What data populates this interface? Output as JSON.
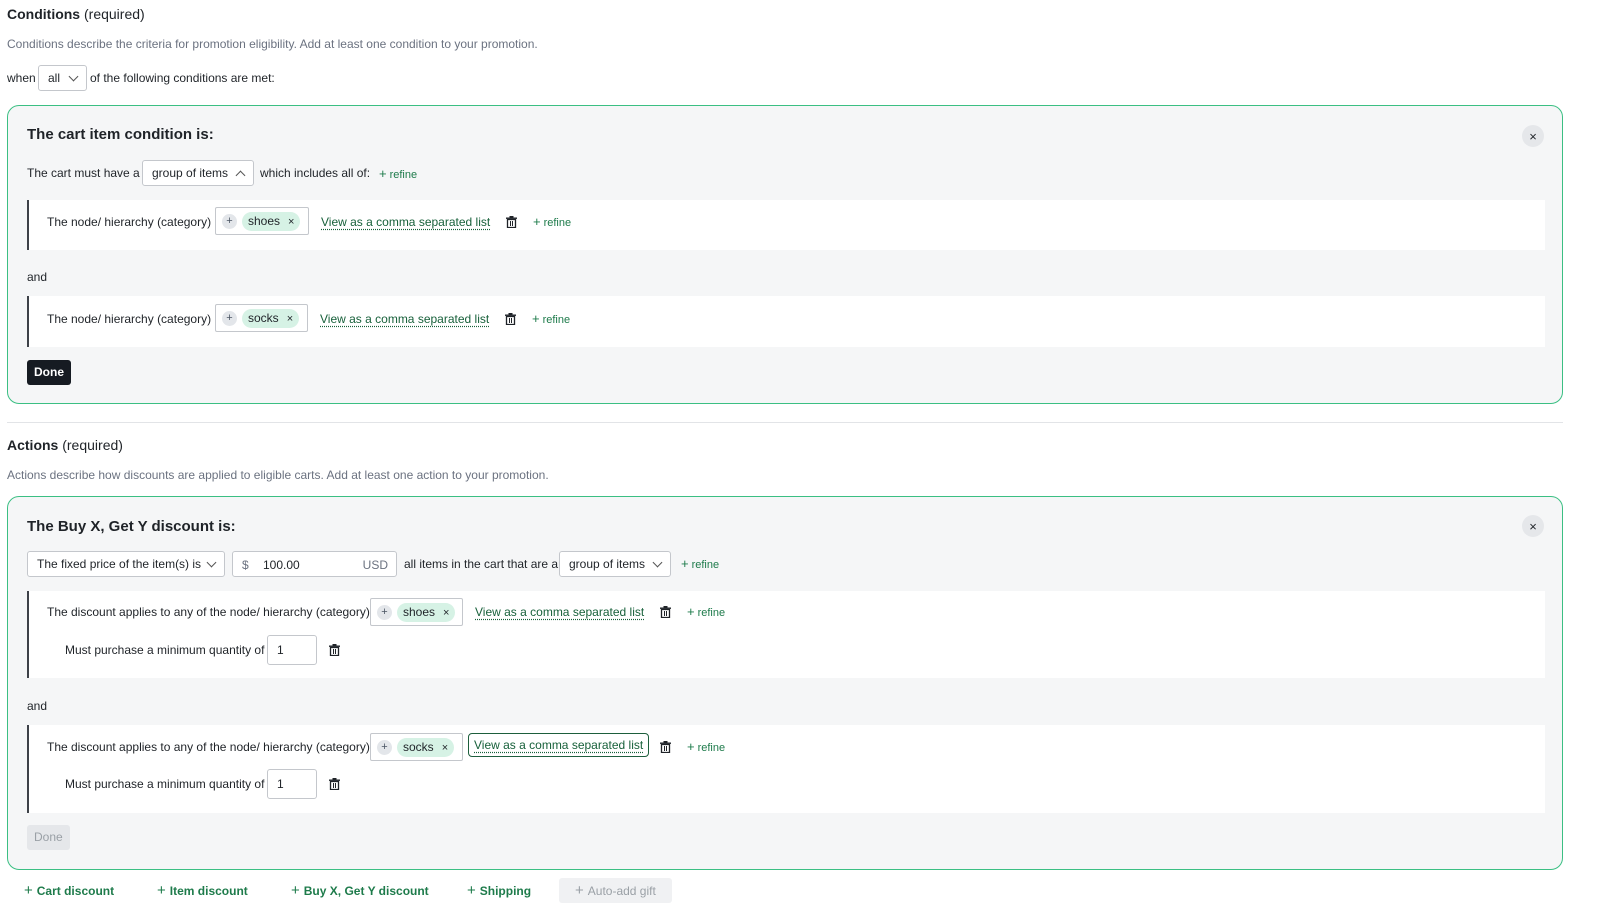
{
  "conditions": {
    "title": "Conditions",
    "required": "(required)",
    "description": "Conditions describe the criteria for promotion eligibility. Add at least one condition to your promotion.",
    "when_label": "when",
    "when_value": "all",
    "when_suffix": "of the following conditions are met:",
    "card": {
      "title": "The cart item condition is:",
      "close": "×",
      "must_have": "The cart must have a",
      "group_select": "group of items",
      "includes": "which includes all of:",
      "refine": "refine",
      "and": "and",
      "rows": [
        {
          "label": "The node/ hierarchy (category)",
          "plus": "+",
          "chip": "shoes",
          "chip_x": "×",
          "link": "View as a comma separated list",
          "refine": "refine"
        },
        {
          "label": "The node/ hierarchy (category)",
          "plus": "+",
          "chip": "socks",
          "chip_x": "×",
          "link": "View as a comma separated list",
          "refine": "refine"
        }
      ],
      "done": "Done"
    }
  },
  "actions": {
    "title": "Actions",
    "required": "(required)",
    "description": "Actions describe how discounts are applied to eligible carts. Add at least one action to your promotion.",
    "card": {
      "title": "The Buy X, Get Y discount is:",
      "close": "×",
      "price_type": "The fixed price of the item(s) is",
      "currency_symbol": "$",
      "price_value": "100.00",
      "currency": "USD",
      "applies_text": "all items in the cart that are a",
      "group_select": "group of items",
      "refine": "refine",
      "and": "and",
      "rows": [
        {
          "label": "The discount applies to any of the node/ hierarchy (category)",
          "plus": "+",
          "chip": "shoes",
          "chip_x": "×",
          "link": "View as a comma separated list",
          "refine": "refine",
          "min_label": "Must purchase a minimum quantity of",
          "min_value": "1"
        },
        {
          "label": "The discount applies to any of the node/ hierarchy (category)",
          "plus": "+",
          "chip": "socks",
          "chip_x": "×",
          "link": "View as a comma separated list",
          "refine": "refine",
          "min_label": "Must purchase a minimum quantity of",
          "min_value": "1"
        }
      ],
      "done": "Done"
    },
    "add_buttons": [
      {
        "plus": "+",
        "label": "Cart discount"
      },
      {
        "plus": "+",
        "label": "Item discount"
      },
      {
        "plus": "+",
        "label": "Buy X, Get Y discount"
      },
      {
        "plus": "+",
        "label": "Shipping"
      },
      {
        "plus": "+",
        "label": "Auto-add gift"
      }
    ]
  },
  "colors": {
    "accent_green": "#3bbf83",
    "link_green": "#17603a",
    "chip_bg": "#d6f2e5",
    "done_bg": "#161b22"
  },
  "icons": {
    "close": "close-icon",
    "trash": "trash-icon",
    "plus": "plus-icon",
    "chevron": "chevron-down-icon"
  }
}
